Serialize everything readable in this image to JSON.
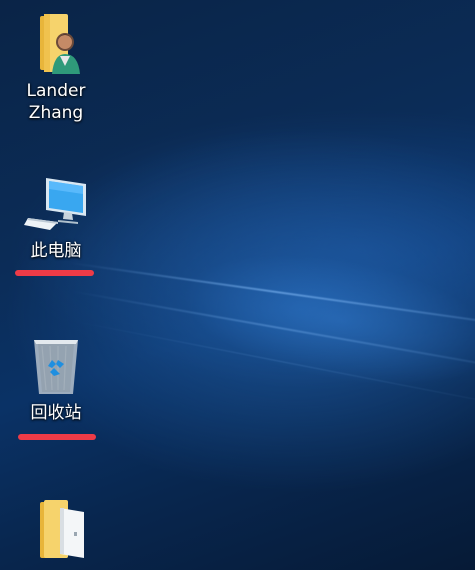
{
  "desktop": {
    "icons": [
      {
        "label": "Lander\nZhang",
        "icon": "user-folder-icon"
      },
      {
        "label": "此电脑",
        "icon": "computer-icon"
      },
      {
        "label": "回收站",
        "icon": "recycle-bin-icon"
      },
      {
        "label": "",
        "icon": "folder-icon"
      }
    ]
  },
  "colors": {
    "annotation": "#ee3b47",
    "folder": "#f3c74f",
    "monitor_screen": "#39a7f0"
  }
}
